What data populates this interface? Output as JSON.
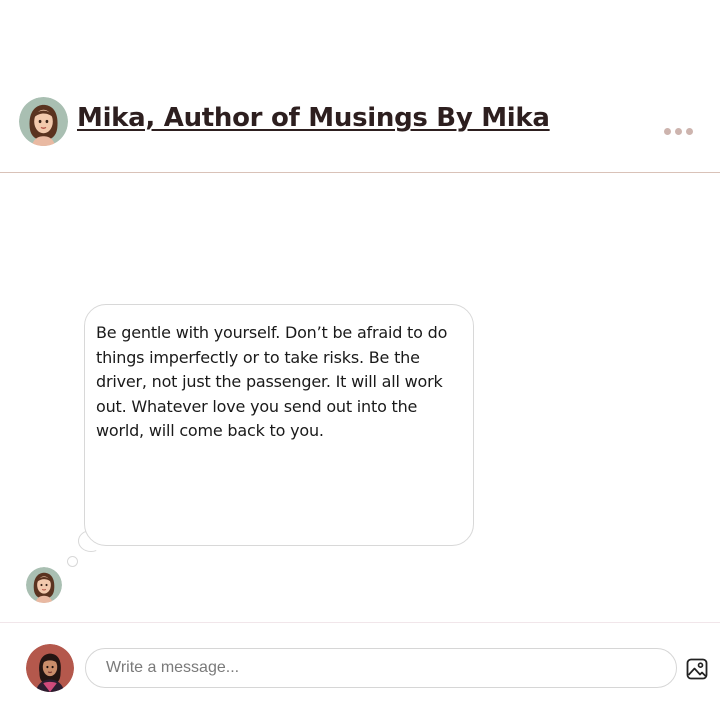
{
  "header": {
    "title": "Mika, Author of Musings By Mika",
    "avatar_icon": "author-avatar",
    "more_icon": "ellipsis-icon"
  },
  "message": {
    "text": "Be gentle with yourself. Don’t be afraid to do things imperfectly or to take risks. Be the driver, not just the passenger. It will all work out. Whatever love you send out into the world, will come back to you."
  },
  "composer": {
    "placeholder": "Write a message...",
    "attach_icon": "image-icon"
  },
  "colors": {
    "divider": "#d9c2b8",
    "dots": "#cdb4ae",
    "title": "#2d1f1f"
  }
}
